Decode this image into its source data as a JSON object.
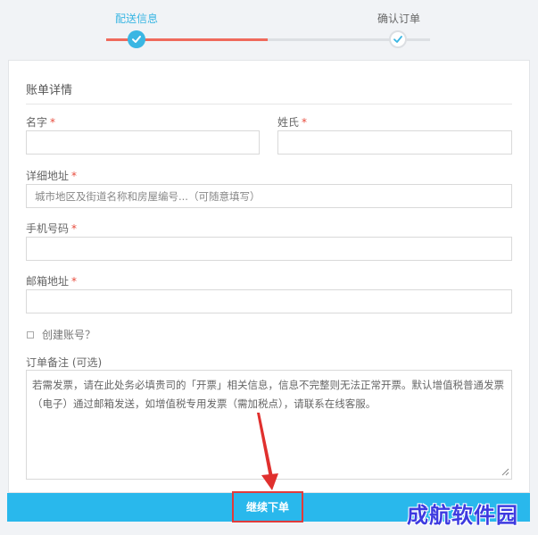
{
  "stepper": {
    "steps": [
      {
        "label": "配送信息",
        "state": "done"
      },
      {
        "label": "确认订单",
        "state": "pending"
      }
    ],
    "colors": {
      "active": "#3ab6e3",
      "progress": "#ef6a5c",
      "track": "#dcdfe3"
    }
  },
  "form": {
    "title": "账单详情",
    "required_mark": "*",
    "first_name": {
      "label": "名字",
      "value": ""
    },
    "last_name": {
      "label": "姓氏",
      "value": ""
    },
    "address": {
      "label": "详细地址",
      "placeholder": "城市地区及街道名称和房屋编号...（可随意填写）",
      "value": ""
    },
    "phone": {
      "label": "手机号码",
      "value": ""
    },
    "email": {
      "label": "邮箱地址",
      "value": ""
    },
    "create_account": {
      "label": "创建账号？",
      "checked": false
    },
    "notes": {
      "label": "订单备注 (可选)",
      "placeholder": "若需发票，请在此处务必填贵司的「开票」相关信息，信息不完整则无法正常开票。默认增值税普通发票（电子）通过邮箱发送，如增值税专用发票（需加税点），请联系在线客服。"
    }
  },
  "submit": {
    "label": "继续下单",
    "color": "#29b8ec",
    "highlight_color": "#e03b3b"
  },
  "watermark": {
    "text": "成航软件园"
  }
}
